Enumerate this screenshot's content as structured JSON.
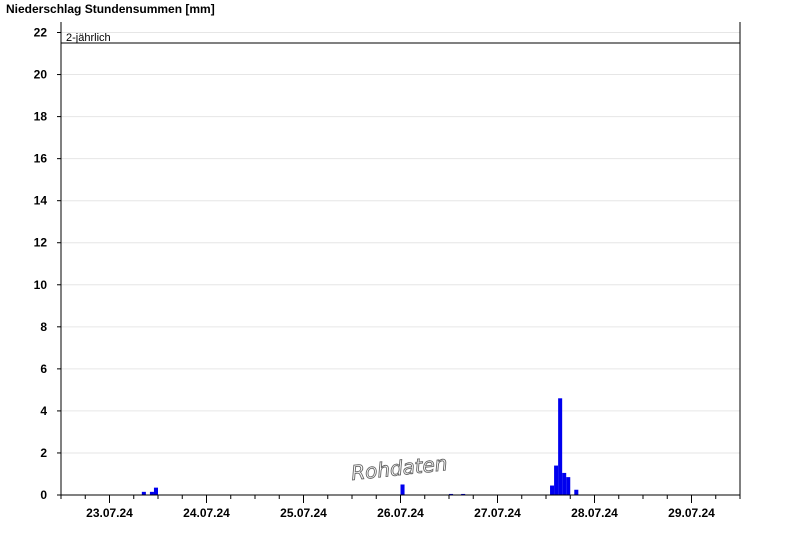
{
  "chart_data": {
    "type": "bar",
    "title": "Niederschlag Stundensummen [mm]",
    "xlabel": "",
    "ylabel": "",
    "ylim": [
      0,
      22.5
    ],
    "yticks": [
      0,
      2,
      4,
      6,
      8,
      10,
      12,
      14,
      16,
      18,
      20,
      22
    ],
    "x_start_hours": -12,
    "x_end_hours": 156,
    "x_tick_labels": [
      "23.07.24",
      "24.07.24",
      "25.07.24",
      "26.07.24",
      "27.07.24",
      "28.07.24",
      "29.07.24"
    ],
    "grid": true,
    "bar_color": "#0000ee",
    "threshold": {
      "label": "2-jährlich",
      "value": 21.5
    },
    "watermark": "Rohdaten",
    "series": [
      {
        "hours_after_23_07_24": [
          8,
          10,
          11,
          72,
          84,
          87,
          109,
          110,
          111,
          112,
          113,
          115
        ],
        "values": [
          0.15,
          0.15,
          0.35,
          0.5,
          0.05,
          0.05,
          0.45,
          1.4,
          4.6,
          1.05,
          0.85,
          0.25
        ]
      }
    ]
  }
}
